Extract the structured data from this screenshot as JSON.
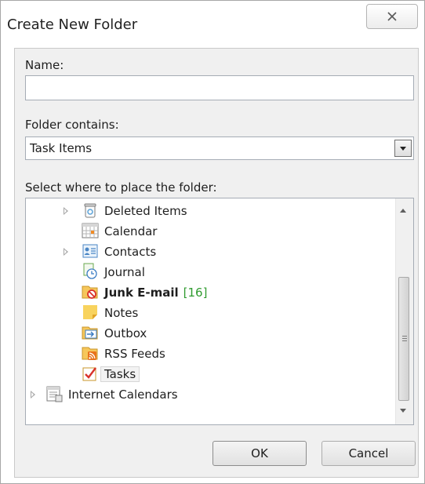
{
  "window": {
    "title": "Create New Folder",
    "close_icon": "close-x-icon"
  },
  "form": {
    "name_label": "Name:",
    "name_value": "",
    "folder_contains_label": "Folder contains:",
    "folder_contains_value": "Task Items",
    "location_label": "Select where to place the folder:"
  },
  "tree": {
    "items": [
      {
        "label": "Deleted Items",
        "icon": "deleted-items-icon",
        "expandable": true,
        "bold": false,
        "count": ""
      },
      {
        "label": "Calendar",
        "icon": "calendar-icon",
        "expandable": false,
        "bold": false,
        "count": ""
      },
      {
        "label": "Contacts",
        "icon": "contacts-icon",
        "expandable": true,
        "bold": false,
        "count": ""
      },
      {
        "label": "Journal",
        "icon": "journal-icon",
        "expandable": false,
        "bold": false,
        "count": ""
      },
      {
        "label": "Junk E-mail",
        "icon": "junk-email-icon",
        "expandable": false,
        "bold": true,
        "count": "[16]"
      },
      {
        "label": "Notes",
        "icon": "notes-icon",
        "expandable": false,
        "bold": false,
        "count": ""
      },
      {
        "label": "Outbox",
        "icon": "outbox-icon",
        "expandable": false,
        "bold": false,
        "count": ""
      },
      {
        "label": "RSS Feeds",
        "icon": "rss-feeds-icon",
        "expandable": false,
        "bold": false,
        "count": ""
      },
      {
        "label": "Tasks",
        "icon": "tasks-icon",
        "expandable": false,
        "bold": false,
        "count": "",
        "selected": true
      },
      {
        "label": "Internet Calendars",
        "icon": "internet-calendars-icon",
        "expandable": true,
        "bold": false,
        "count": ""
      }
    ]
  },
  "buttons": {
    "ok": "OK",
    "cancel": "Cancel"
  },
  "colors": {
    "count_green": "#2f9b2f",
    "dialog_bg": "#f0f0f0"
  }
}
